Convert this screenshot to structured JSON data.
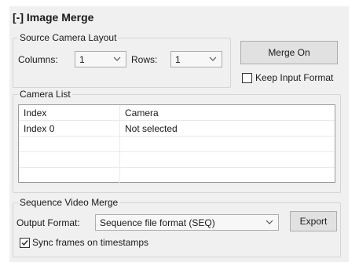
{
  "title": "[-] Image Merge",
  "source_layout": {
    "legend": "Source Camera Layout",
    "columns_label": "Columns:",
    "columns_value": "1",
    "rows_label": "Rows:",
    "rows_value": "1"
  },
  "merge_button": "Merge On",
  "keep_input_format": {
    "label": "Keep Input Format",
    "checked": false
  },
  "camera_list": {
    "legend": "Camera List",
    "headers": [
      "Index",
      "Camera"
    ],
    "rows": [
      [
        "Index 0",
        "Not selected"
      ],
      [
        "",
        ""
      ],
      [
        "",
        ""
      ],
      [
        "",
        ""
      ]
    ]
  },
  "sequence": {
    "legend": "Sequence Video Merge",
    "output_label": "Output Format:",
    "output_value": "Sequence file format (SEQ)",
    "export_label": "Export",
    "sync_label": "Sync frames on timestamps",
    "sync_checked": true
  },
  "icons": [
    "chevron-down-icon",
    "checkmark-icon"
  ],
  "colors": {
    "panel": "#f0f0f0",
    "border": "#d5d5d5",
    "button": "#e1e1e1"
  }
}
